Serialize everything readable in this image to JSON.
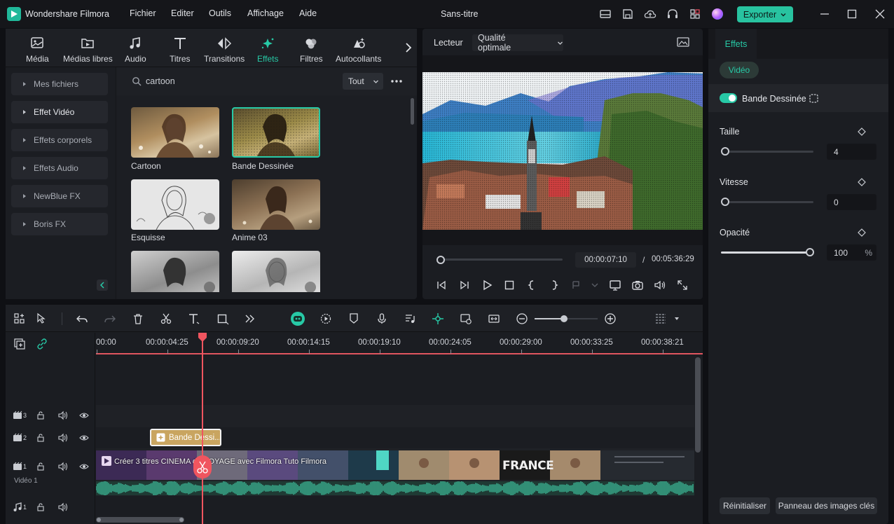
{
  "app": {
    "title": "Wondershare Filmora",
    "document_title": "Sans-titre"
  },
  "menu": [
    "Fichier",
    "Editer",
    "Outils",
    "Affichage",
    "Aide"
  ],
  "export_label": "Exporter",
  "media_tabs": [
    {
      "label": "Média",
      "icon": "media-icon"
    },
    {
      "label": "Médias libres",
      "icon": "stock-media-icon"
    },
    {
      "label": "Audio",
      "icon": "music-note-icon"
    },
    {
      "label": "Titres",
      "icon": "text-t-icon"
    },
    {
      "label": "Transitions",
      "icon": "transitions-icon"
    },
    {
      "label": "Effets",
      "icon": "effects-sparkle-icon",
      "active": true
    },
    {
      "label": "Filtres",
      "icon": "filters-icon"
    },
    {
      "label": "Autocollants",
      "icon": "stickers-icon"
    }
  ],
  "categories": [
    "Mes fichiers",
    "Effet Vidéo",
    "Effets corporels",
    "Effets Audio",
    "NewBlue FX",
    "Boris FX"
  ],
  "search": {
    "value": "cartoon",
    "filter": "Tout"
  },
  "effects": [
    {
      "label": "Cartoon"
    },
    {
      "label": "Bande Dessinée",
      "selected": true
    },
    {
      "label": "Esquisse"
    },
    {
      "label": "Anime 03"
    },
    {
      "label": ""
    },
    {
      "label": ""
    }
  ],
  "player": {
    "label": "Lecteur",
    "quality": "Qualité optimale",
    "current_time": "00:00:07:10",
    "separator": "/",
    "total_time": "00:05:36:29",
    "progress": 0.02
  },
  "ruler": [
    "00:00",
    "00:00:04:25",
    "00:00:09:20",
    "00:00:14:15",
    "00:00:19:10",
    "00:00:24:05",
    "00:00:29:00",
    "00:00:33:25",
    "00:00:38:21"
  ],
  "tracks": {
    "v3": "3",
    "v2": "2",
    "v1": "1",
    "v1_name": "Vidéo 1",
    "a1": "1",
    "effect_clip": "Bande Dessi...",
    "video_clip": "Créer 3 titres CINEMA de VOYAGE avec Filmora  Tuto Filmora",
    "france_text": "FRANCE"
  },
  "right_panel": {
    "tab": "Effets",
    "subtab": "Vidéo",
    "effect_name": "Bande Dessinée",
    "params": [
      {
        "label": "Taille",
        "value": "4",
        "level": 0.0
      },
      {
        "label": "Vitesse",
        "value": "0",
        "level": 0.0
      },
      {
        "label": "Opacité",
        "value": "100",
        "unit": "%",
        "level": 1.0
      }
    ],
    "reset": "Réinitialiser",
    "keyframes": "Panneau des images clés"
  },
  "colors": {
    "accent": "#28c3a0",
    "playhead": "#f0555f",
    "effect_clip": "#c9a560"
  }
}
